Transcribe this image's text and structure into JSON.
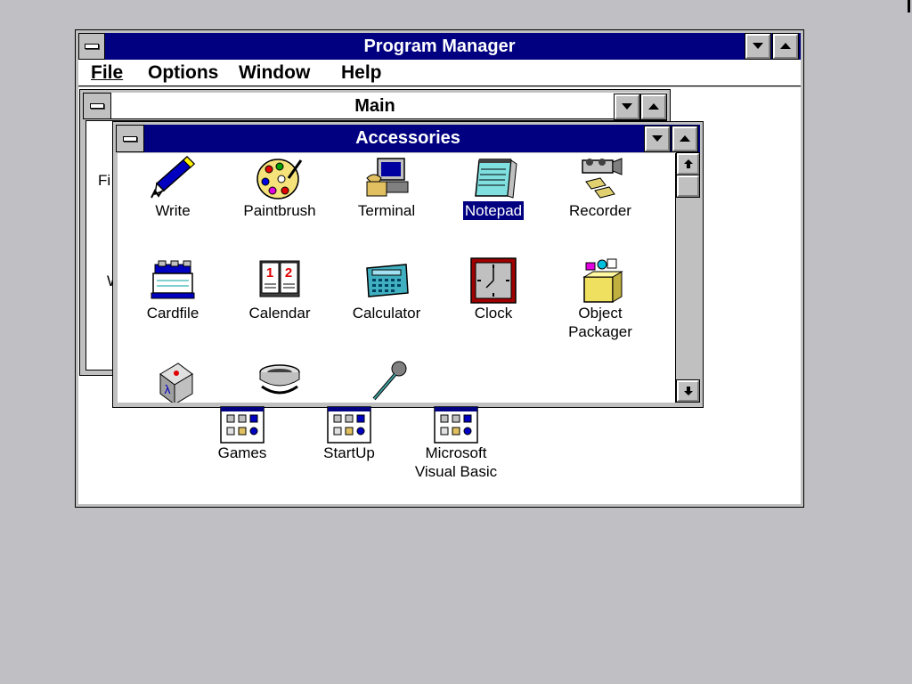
{
  "program_manager": {
    "title": "Program Manager",
    "menu": [
      "File",
      "Options",
      "Window",
      "Help"
    ]
  },
  "main_window": {
    "title": "Main",
    "partial_labels": [
      "Fi",
      "W"
    ]
  },
  "accessories_window": {
    "title": "Accessories",
    "icons": [
      {
        "label": "Write",
        "icon": "write-pen-icon"
      },
      {
        "label": "Paintbrush",
        "icon": "palette-icon"
      },
      {
        "label": "Terminal",
        "icon": "terminal-phone-icon"
      },
      {
        "label": "Notepad",
        "icon": "notepad-icon",
        "selected": true
      },
      {
        "label": "Recorder",
        "icon": "camcorder-icon"
      },
      {
        "label": "Cardfile",
        "icon": "cardfile-icon"
      },
      {
        "label": "Calendar",
        "icon": "calendar-icon"
      },
      {
        "label": "Calculator",
        "icon": "calculator-icon"
      },
      {
        "label": "Clock",
        "icon": "clock-icon"
      },
      {
        "label": "Object\nPackager",
        "icon": "package-icon"
      },
      {
        "label": "",
        "icon": "character-map-icon"
      },
      {
        "label": "",
        "icon": "media-player-icon"
      },
      {
        "label": "",
        "icon": "sound-recorder-icon"
      }
    ]
  },
  "group_icons": [
    {
      "label": "Games",
      "icon": "program-group-icon"
    },
    {
      "label": "StartUp",
      "icon": "program-group-icon"
    },
    {
      "label": "Microsoft\nVisual Basic",
      "icon": "program-group-icon"
    }
  ],
  "colors": {
    "desktop": "#c0c0c4",
    "active_title": "#000080",
    "window_bg": "#ffffff",
    "face": "#c0c0c0"
  }
}
